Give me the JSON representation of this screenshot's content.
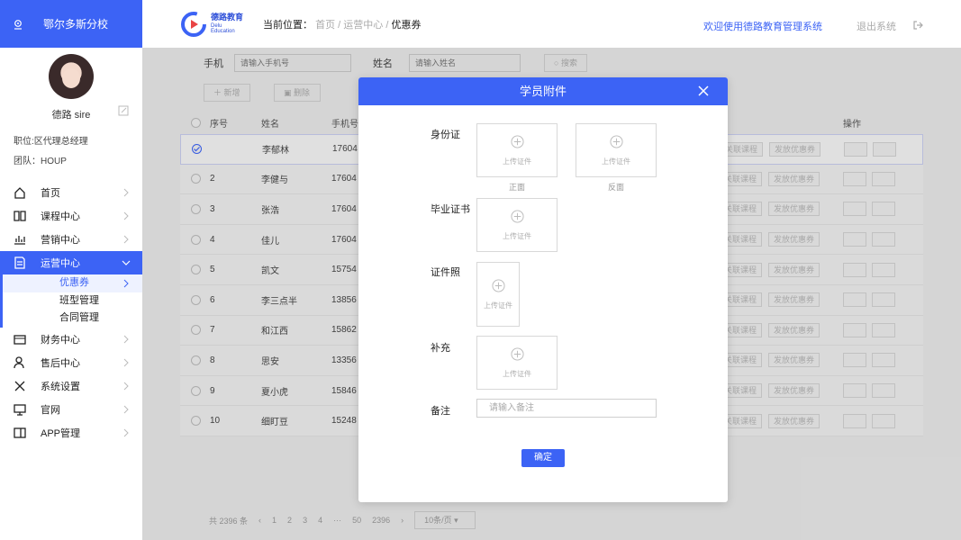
{
  "sidebar": {
    "branch": "鄂尔多斯分校",
    "user_name": "德路 sire",
    "position_label": "职位:区代理总经理",
    "team_label": "团队：HOUP",
    "nav": [
      {
        "label": "首页"
      },
      {
        "label": "课程中心"
      },
      {
        "label": "营销中心"
      },
      {
        "label": "运营中心"
      },
      {
        "label": "财务中心"
      },
      {
        "label": "售后中心"
      },
      {
        "label": "系统设置"
      },
      {
        "label": "官网"
      },
      {
        "label": "APP管理"
      }
    ],
    "sub": [
      {
        "label": "优惠券"
      },
      {
        "label": "班型管理"
      },
      {
        "label": "合同管理"
      }
    ]
  },
  "header": {
    "logo_cn": "德路教育",
    "logo_en_1": "Delu",
    "logo_en_2": "Education",
    "crumb_prefix": "当前位置：",
    "crumb_1": "首页",
    "sep": "/",
    "crumb_2": "运营中心",
    "crumb_3": "优惠券",
    "welcome": "欢迎使用德路教育管理系统",
    "logout": "退出系统"
  },
  "filters": {
    "phone_label": "手机",
    "phone_placeholder": "请输入手机号",
    "name_label": "姓名",
    "name_placeholder": "请输入姓名",
    "search": "搜索",
    "add": "新增",
    "delete": "删除"
  },
  "table": {
    "headers": {
      "no": "序号",
      "name": "姓名",
      "phone": "手机号",
      "ops": "操作"
    },
    "chip_course": "关联课程",
    "chip_coupon": "发放优惠券",
    "rows": [
      {
        "no": "",
        "name": "李郁林",
        "phone": "17604"
      },
      {
        "no": "2",
        "name": "李健与",
        "phone": "17604"
      },
      {
        "no": "3",
        "name": "张浩",
        "phone": "17604"
      },
      {
        "no": "4",
        "name": "佳儿",
        "phone": "17604"
      },
      {
        "no": "5",
        "name": "凯文",
        "phone": "15754"
      },
      {
        "no": "6",
        "name": "李三点半",
        "phone": "13856"
      },
      {
        "no": "7",
        "name": "和江西",
        "phone": "15862"
      },
      {
        "no": "8",
        "name": "思安",
        "phone": "13356"
      },
      {
        "no": "9",
        "name": "夏小虎",
        "phone": "15846"
      },
      {
        "no": "10",
        "name": "细盯豆",
        "phone": "15248"
      }
    ]
  },
  "pager": {
    "total": "共 2396 条",
    "p1": "1",
    "p2": "2",
    "p3": "3",
    "p4": "4",
    "ellipsis": "···",
    "p50": "50",
    "last": "2396",
    "per_page": "10条/页"
  },
  "modal": {
    "title": "学员附件",
    "id_card": "身份证",
    "diploma": "毕业证书",
    "photo": "证件照",
    "supplement": "补充",
    "note": "备注",
    "upload_text": "上传证件",
    "front": "正面",
    "back": "反面",
    "note_placeholder": "请输入备注",
    "confirm": "确定"
  }
}
